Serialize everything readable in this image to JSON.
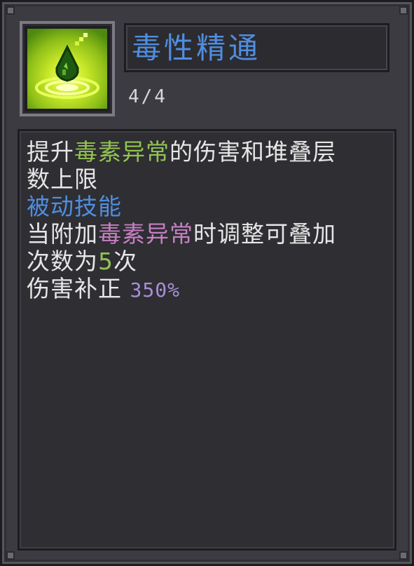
{
  "skill": {
    "name": "毒性精通",
    "level": "4/4",
    "icon": "poison-drop-icon"
  },
  "description": {
    "line1": {
      "a": "提升",
      "b": "毒素异常",
      "c": "的伤害和堆叠层"
    },
    "line2": "数上限",
    "line3": "被动技能",
    "line4": {
      "a": "当附加",
      "b": "毒素异常",
      "c": "时调整可叠加"
    },
    "line5": {
      "a": "次数为",
      "b": "5",
      "c": "次"
    },
    "line6": {
      "a": "伤害补正 ",
      "b": "350%"
    }
  },
  "colors": {
    "title": "#4f8ee0",
    "green": "#93c450",
    "blue": "#4f8ee0",
    "pink": "#c77fc2",
    "purple": "#a88fd6"
  }
}
